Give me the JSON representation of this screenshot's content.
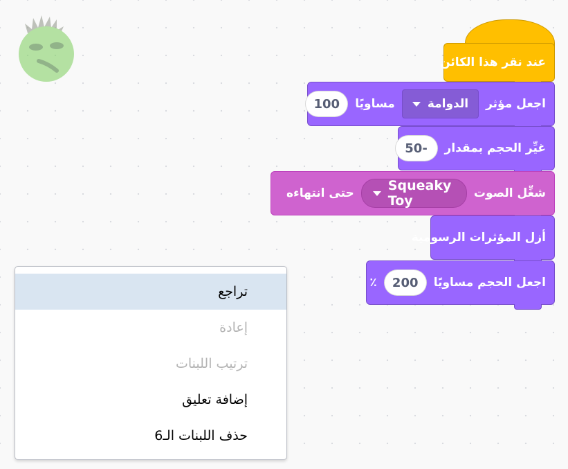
{
  "sprite": {
    "name": "face-sprite"
  },
  "blocks": {
    "hat": {
      "label": "عند نقر هذا الكائن"
    },
    "set_effect": {
      "label": "اجعل مؤثر",
      "effect": "الدوامة",
      "mid": "مساويًا",
      "value": "100"
    },
    "change_size": {
      "label": "غيِّر الحجم بمقدار",
      "value": "-50"
    },
    "play_sound": {
      "label": "شغِّل الصوت",
      "sound": "Squeaky Toy",
      "suffix": "حتى انتهاءه"
    },
    "clear_effects": {
      "label": "أزل المؤثرات الرسومية"
    },
    "set_size": {
      "label": "اجعل الحجم مساويًا",
      "value": "200",
      "unit": "٪"
    }
  },
  "context_menu": {
    "items": [
      {
        "label": "تراجع",
        "state": "active"
      },
      {
        "label": "إعادة",
        "state": "disabled"
      },
      {
        "label": "ترتيب اللبنات",
        "state": "disabled"
      },
      {
        "label": "إضافة تعليق",
        "state": "enabled"
      },
      {
        "label": "حذف اللبنات الـ6",
        "state": "enabled"
      }
    ]
  },
  "colors": {
    "looks": "#9966ff",
    "sound": "#cf63cf",
    "events": "#ffbf00",
    "menu_highlight": "#d9e5f1"
  }
}
